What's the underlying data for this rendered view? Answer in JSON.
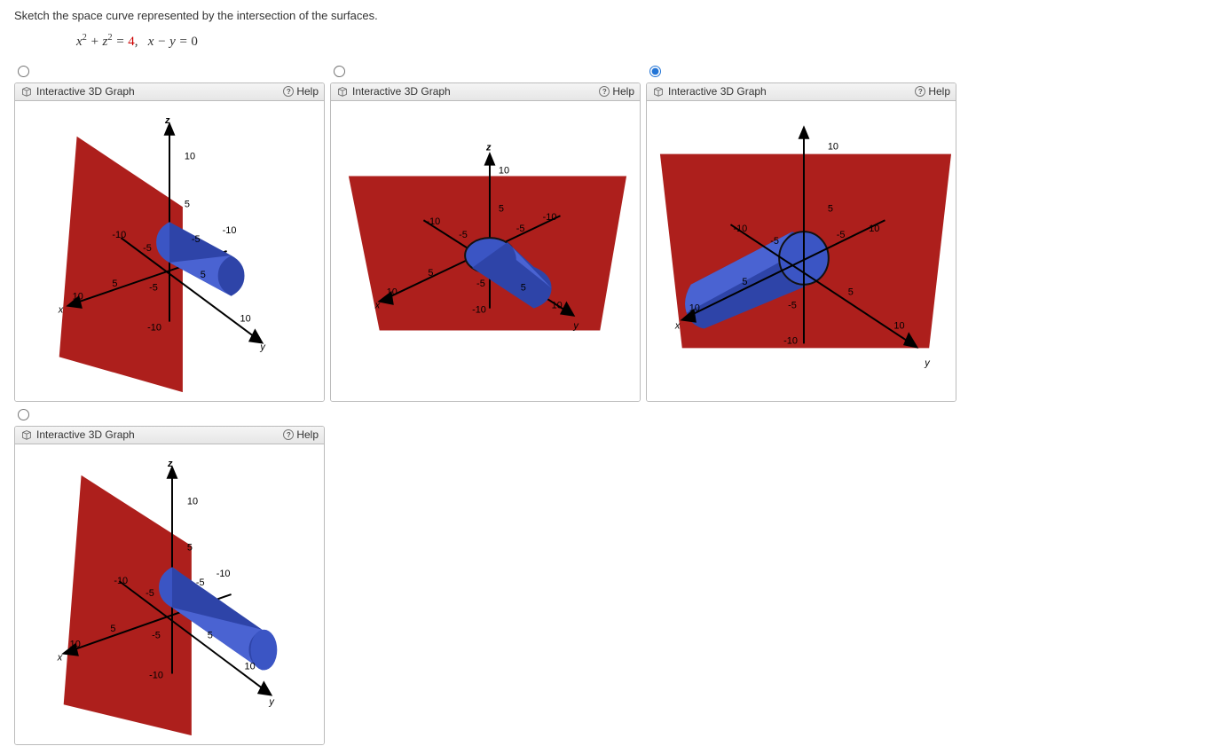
{
  "question": "Sketch the space curve represented by the intersection of the surfaces.",
  "equation": {
    "lhs_html": "x<sup>2</sup> + z<sup>2</sup> = ",
    "rhs_red": "4",
    "second": ",   x − y = 0"
  },
  "panel": {
    "title": "Interactive 3D Graph",
    "help": "Help"
  },
  "options": [
    {
      "id": "opt1",
      "selected": false,
      "view": "A"
    },
    {
      "id": "opt2",
      "selected": false,
      "view": "B"
    },
    {
      "id": "opt3",
      "selected": true,
      "view": "C"
    },
    {
      "id": "opt4",
      "selected": false,
      "view": "D"
    }
  ],
  "axis_labels": {
    "x": "x",
    "y": "y",
    "z": "z",
    "ticks": [
      "-10",
      "-5",
      "5",
      "10"
    ]
  }
}
